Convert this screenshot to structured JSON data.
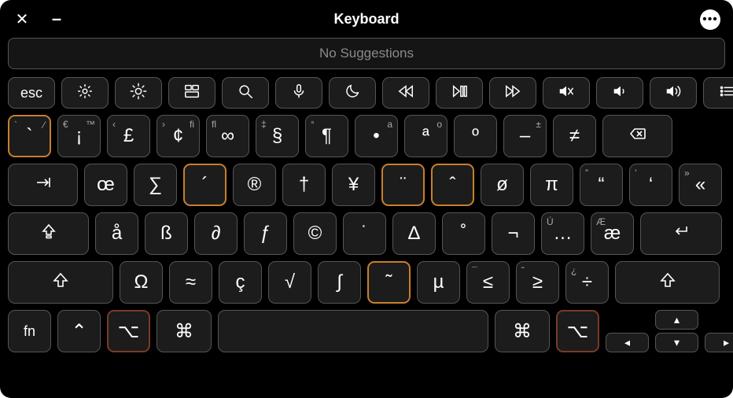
{
  "window": {
    "title": "Keyboard"
  },
  "titlebar": {
    "close": "✕",
    "minimize": "–",
    "more": "•••"
  },
  "suggestions": {
    "text": "No Suggestions"
  },
  "fn_row": {
    "esc": "esc"
  },
  "row1": [
    {
      "name": "grave",
      "label": "`",
      "tl": "`",
      "tr": "⁄",
      "cls": "orange"
    },
    {
      "name": "1",
      "label": "¡",
      "tl": "€",
      "tr": "™"
    },
    {
      "name": "2",
      "label": "£",
      "tl": "‹",
      "tr": ""
    },
    {
      "name": "3",
      "label": "¢",
      "tl": "›",
      "tr": "fi"
    },
    {
      "name": "4",
      "label": "∞",
      "tl": "fl",
      "tr": ""
    },
    {
      "name": "5",
      "label": "§",
      "tl": "‡",
      "tr": ""
    },
    {
      "name": "6",
      "label": "¶",
      "tl": "°",
      "tr": ""
    },
    {
      "name": "7",
      "label": "•",
      "tl": "",
      "tr": "a"
    },
    {
      "name": "8",
      "label": "ª",
      "tl": "",
      "tr": "o"
    },
    {
      "name": "9",
      "label": "º",
      "tl": "",
      "tr": ""
    },
    {
      "name": "0",
      "label": "–",
      "tl": "",
      "tr": "±"
    },
    {
      "name": "minus",
      "label": "≠",
      "tl": "",
      "tr": ""
    }
  ],
  "row2": [
    {
      "name": "q",
      "label": "œ"
    },
    {
      "name": "w",
      "label": "∑"
    },
    {
      "name": "e",
      "label": "´",
      "cls": "orange"
    },
    {
      "name": "r",
      "label": "®"
    },
    {
      "name": "t",
      "label": "†"
    },
    {
      "name": "y",
      "label": "¥"
    },
    {
      "name": "u",
      "label": "¨",
      "cls": "orange"
    },
    {
      "name": "i",
      "label": "ˆ",
      "cls": "orange"
    },
    {
      "name": "o",
      "label": "ø"
    },
    {
      "name": "p",
      "label": "π"
    },
    {
      "name": "lbracket",
      "label": "“",
      "tl": "”"
    },
    {
      "name": "rbracket",
      "label": "‘",
      "tl": "’"
    },
    {
      "name": "backslash",
      "label": "«",
      "tl": "»"
    }
  ],
  "row3": [
    {
      "name": "a",
      "label": "å"
    },
    {
      "name": "s",
      "label": "ß"
    },
    {
      "name": "d",
      "label": "∂"
    },
    {
      "name": "f",
      "label": "ƒ"
    },
    {
      "name": "g",
      "label": "©"
    },
    {
      "name": "h",
      "label": "˙"
    },
    {
      "name": "j",
      "label": "∆"
    },
    {
      "name": "k",
      "label": "˚"
    },
    {
      "name": "l",
      "label": "¬"
    },
    {
      "name": "semicolon",
      "label": "…",
      "tl": "Ú"
    },
    {
      "name": "quote",
      "label": "æ",
      "tl": "Æ"
    }
  ],
  "row4": [
    {
      "name": "z",
      "label": "Ω"
    },
    {
      "name": "x",
      "label": "≈"
    },
    {
      "name": "c",
      "label": "ç"
    },
    {
      "name": "v",
      "label": "√"
    },
    {
      "name": "b",
      "label": "∫"
    },
    {
      "name": "n",
      "label": "˜",
      "cls": "orange"
    },
    {
      "name": "m",
      "label": "µ"
    },
    {
      "name": "comma",
      "label": "≤",
      "tl": "¯"
    },
    {
      "name": "period",
      "label": "≥",
      "tl": "˘"
    },
    {
      "name": "slash",
      "label": "÷",
      "tl": "¿"
    }
  ],
  "row5": {
    "fn": "fn",
    "ctrl": "⌃",
    "opt": "⌥",
    "cmd": "⌘"
  },
  "arrows": {
    "up": "▴",
    "left": "◂",
    "down": "▾",
    "right": "▸"
  }
}
